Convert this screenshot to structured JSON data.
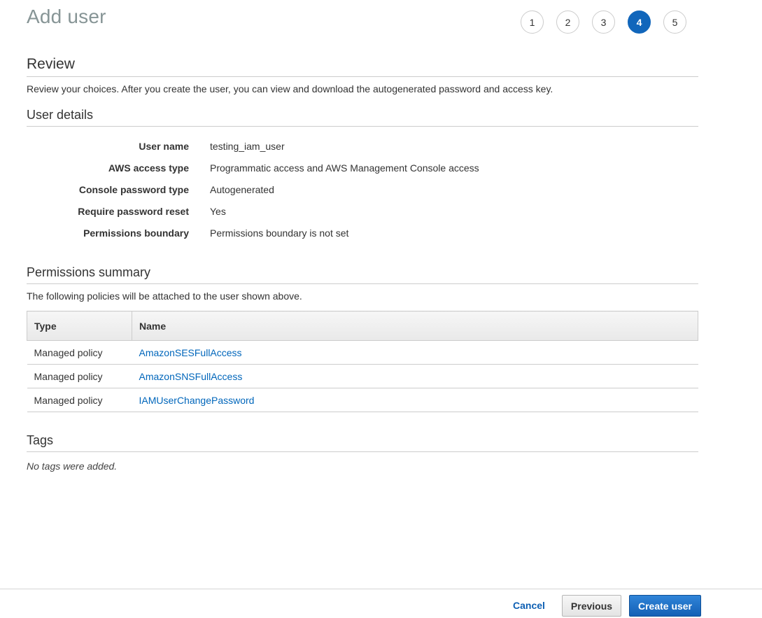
{
  "page_title": "Add user",
  "steps": [
    {
      "label": "1",
      "active": false
    },
    {
      "label": "2",
      "active": false
    },
    {
      "label": "3",
      "active": false
    },
    {
      "label": "4",
      "active": true
    },
    {
      "label": "5",
      "active": false
    }
  ],
  "review": {
    "heading": "Review",
    "description": "Review your choices. After you create the user, you can view and download the autogenerated password and access key."
  },
  "user_details": {
    "heading": "User details",
    "rows": [
      {
        "label": "User name",
        "value": "testing_iam_user"
      },
      {
        "label": "AWS access type",
        "value": "Programmatic access and AWS Management Console access"
      },
      {
        "label": "Console password type",
        "value": "Autogenerated"
      },
      {
        "label": "Require password reset",
        "value": "Yes"
      },
      {
        "label": "Permissions boundary",
        "value": "Permissions boundary is not set"
      }
    ]
  },
  "permissions": {
    "heading": "Permissions summary",
    "description": "The following policies will be attached to the user shown above.",
    "columns": [
      "Type",
      "Name"
    ],
    "rows": [
      {
        "type": "Managed policy",
        "name": "AmazonSESFullAccess"
      },
      {
        "type": "Managed policy",
        "name": "AmazonSNSFullAccess"
      },
      {
        "type": "Managed policy",
        "name": "IAMUserChangePassword"
      }
    ]
  },
  "tags": {
    "heading": "Tags",
    "empty_text": "No tags were added."
  },
  "footer": {
    "cancel_label": "Cancel",
    "previous_label": "Previous",
    "create_label": "Create user"
  },
  "colors": {
    "accent": "#1166bb",
    "link": "#0066bb",
    "title_gray": "#879596"
  }
}
